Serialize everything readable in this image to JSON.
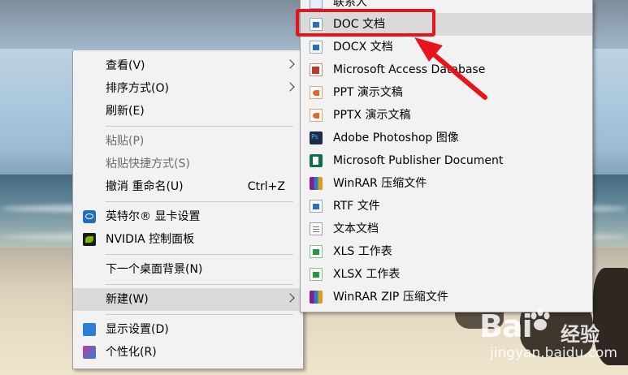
{
  "main_menu": {
    "items": [
      {
        "label": "查看(V)",
        "submenu": true
      },
      {
        "label": "排序方式(O)",
        "submenu": true
      },
      {
        "label": "刷新(E)"
      },
      {
        "label": "粘贴(P)",
        "disabled": true
      },
      {
        "label": "粘贴快捷方式(S)",
        "disabled": true
      },
      {
        "label": "撤消 重命名(U)",
        "shortcut": "Ctrl+Z"
      },
      {
        "label": "英特尔® 显卡设置",
        "icon": "intel-graphics-icon"
      },
      {
        "label": "NVIDIA 控制面板",
        "icon": "nvidia-icon"
      },
      {
        "label": "下一个桌面背景(N)"
      },
      {
        "label": "新建(W)",
        "submenu": true,
        "highlighted": true
      },
      {
        "label": "显示设置(D)",
        "icon": "display-settings-icon"
      },
      {
        "label": "个性化(R)",
        "icon": "personalize-icon"
      }
    ]
  },
  "new_submenu": {
    "items": [
      {
        "label": "联系人",
        "icon": "contact-icon"
      },
      {
        "label": "DOC 文档",
        "icon": "word-doc-icon",
        "highlighted": true
      },
      {
        "label": "DOCX 文档",
        "icon": "word-docx-icon"
      },
      {
        "label": "Microsoft Access Database",
        "icon": "access-icon"
      },
      {
        "label": "PPT 演示文稿",
        "icon": "ppt-icon"
      },
      {
        "label": "PPTX 演示文稿",
        "icon": "pptx-icon"
      },
      {
        "label": "Adobe Photoshop 图像",
        "icon": "photoshop-icon"
      },
      {
        "label": "Microsoft Publisher Document",
        "icon": "publisher-icon"
      },
      {
        "label": "WinRAR 压缩文件",
        "icon": "winrar-icon"
      },
      {
        "label": "RTF 文件",
        "icon": "rtf-icon"
      },
      {
        "label": "文本文档",
        "icon": "text-file-icon"
      },
      {
        "label": "XLS 工作表",
        "icon": "xls-icon"
      },
      {
        "label": "XLSX 工作表",
        "icon": "xlsx-icon"
      },
      {
        "label": "WinRAR ZIP 压缩文件",
        "icon": "winrar-zip-icon"
      }
    ]
  },
  "watermark": {
    "brand": "Bai",
    "brand_suffix": "经验",
    "url": "jingyan.baidu.com"
  },
  "colors": {
    "menu_bg": "#f2f2f2",
    "hover_bg": "#dadada",
    "annotation_red": "#e8141c"
  }
}
